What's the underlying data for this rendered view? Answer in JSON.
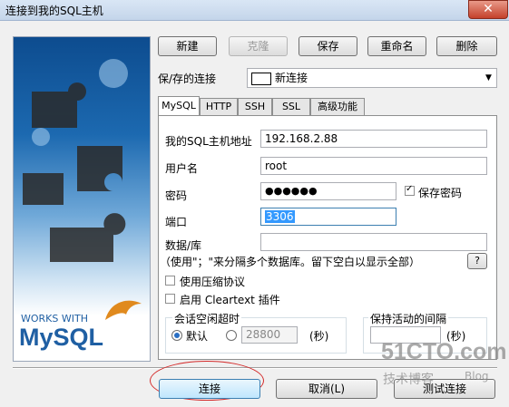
{
  "window": {
    "title": "连接到我的SQL主机"
  },
  "toolbar": {
    "new_label": "新建",
    "clone_label": "克隆",
    "save_label": "保存",
    "rename_label": "重命名",
    "delete_label": "删除"
  },
  "saved_connection": {
    "label": "保/存的连接",
    "value": "新连接"
  },
  "tabs": [
    "MySQL",
    "HTTP",
    "SSH",
    "SSL",
    "高级功能"
  ],
  "form": {
    "host_label": "我的SQL主机地址",
    "host_value": "192.168.2.88",
    "user_label": "用户名",
    "user_value": "root",
    "password_label": "密码",
    "password_value": "●●●●●●",
    "save_password_label": "保存密码",
    "port_label": "端口",
    "port_value": "3306",
    "database_label": "数据/库",
    "database_value": "",
    "database_hint": "（使用\"；\"来分隔多个数据库。留下空白以显示全部）",
    "help_label": "?",
    "compress_label": "使用压缩协议",
    "cleartext_label": "启用 Cleartext 插件"
  },
  "session_timeout": {
    "title": "会话空闲超时",
    "default_label": "默认",
    "value": "28800",
    "unit": "(秒)"
  },
  "keepalive": {
    "title": "保持活动的间隔",
    "unit": "(秒)"
  },
  "logo": {
    "works_with": "WORKS WITH",
    "brand": "MySQL"
  },
  "bottom": {
    "connect_label": "连接",
    "cancel_label": "取消(L)",
    "test_label": "测试连接"
  },
  "watermark": {
    "site": "51CTO.com",
    "sub": "技术博客",
    "blog": "Blog"
  }
}
